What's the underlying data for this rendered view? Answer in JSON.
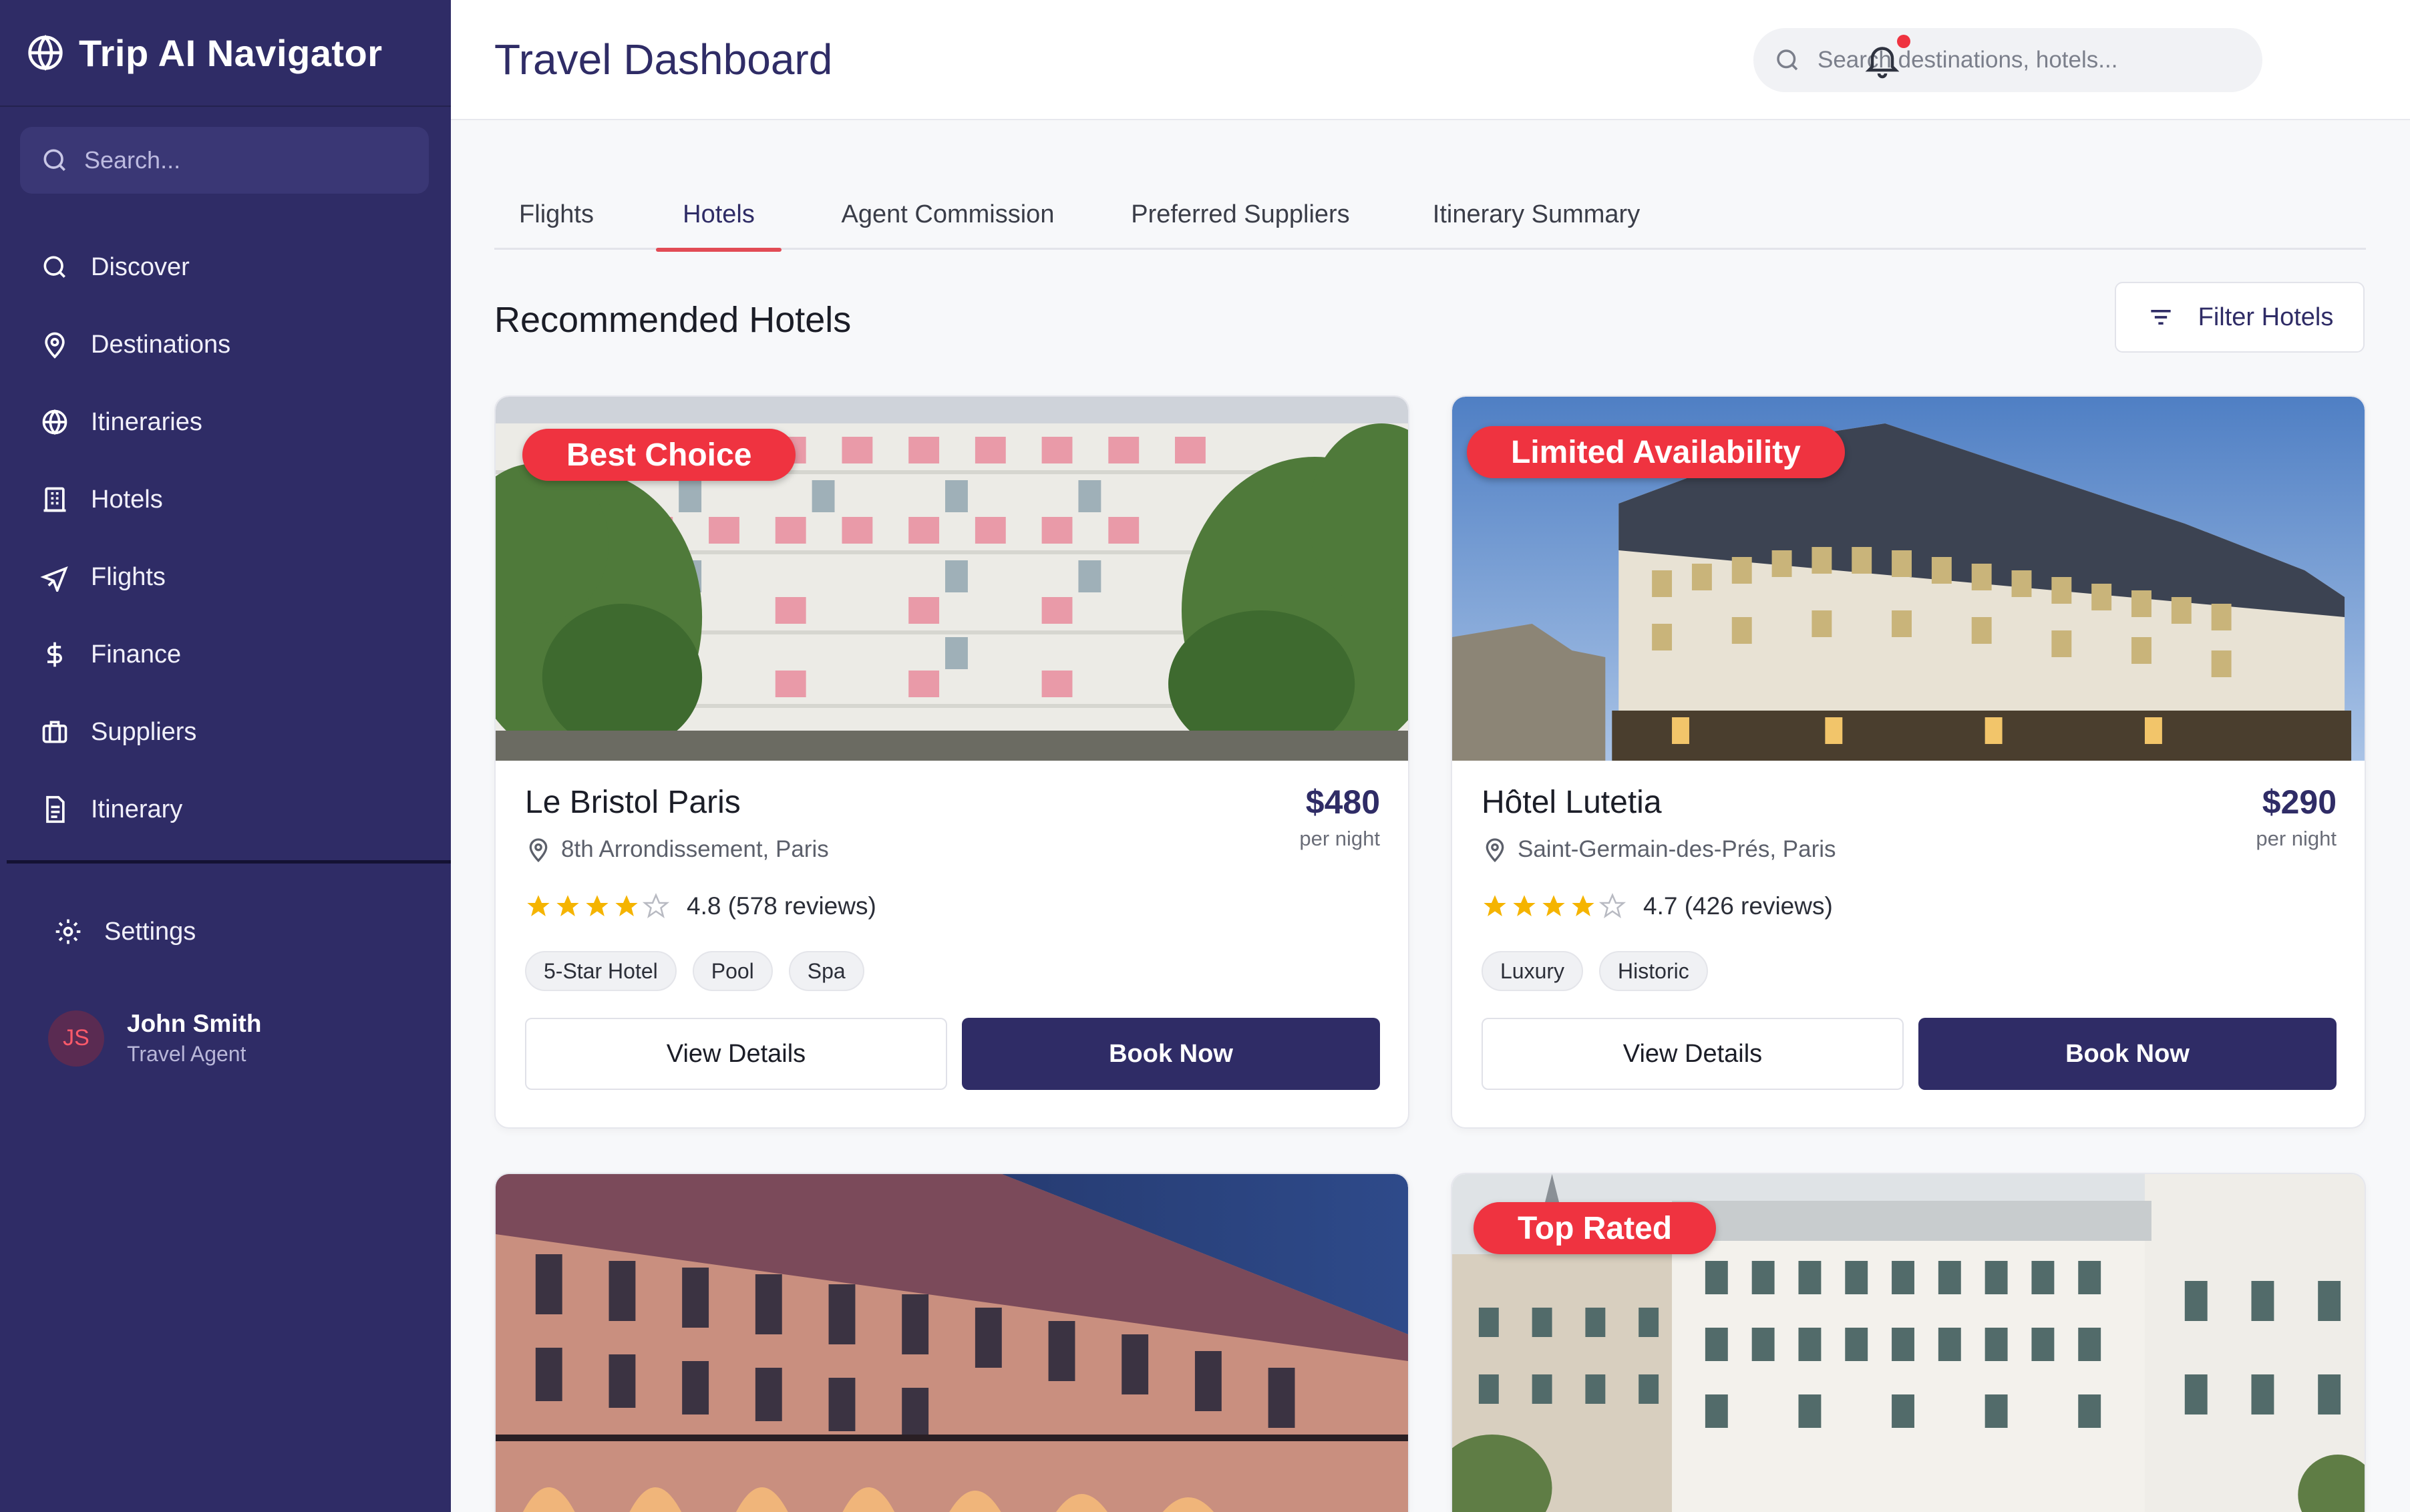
{
  "app": {
    "brand": "Trip AI Navigator"
  },
  "sidebar": {
    "search_placeholder": "Search...",
    "items": [
      {
        "label": "Discover",
        "icon": "search-icon"
      },
      {
        "label": "Destinations",
        "icon": "map-pin-icon"
      },
      {
        "label": "Itineraries",
        "icon": "globe-icon"
      },
      {
        "label": "Hotels",
        "icon": "building-icon"
      },
      {
        "label": "Flights",
        "icon": "plane-icon"
      },
      {
        "label": "Finance",
        "icon": "dollar-icon"
      },
      {
        "label": "Suppliers",
        "icon": "briefcase-icon"
      },
      {
        "label": "Itinerary",
        "icon": "document-icon"
      }
    ],
    "settings_label": "Settings",
    "user": {
      "initials": "JS",
      "name": "John Smith",
      "role": "Travel Agent"
    }
  },
  "header": {
    "title": "Travel Dashboard",
    "search_placeholder": "Search destinations, hotels..."
  },
  "tabs": [
    {
      "label": "Flights",
      "active": false
    },
    {
      "label": "Hotels",
      "active": true
    },
    {
      "label": "Agent Commission",
      "active": false
    },
    {
      "label": "Preferred Suppliers",
      "active": false
    },
    {
      "label": "Itinerary Summary",
      "active": false
    }
  ],
  "section": {
    "title": "Recommended Hotels",
    "filter_label": "Filter Hotels"
  },
  "hotels": [
    {
      "badge": "Best Choice",
      "name": "Le Bristol Paris",
      "location": "8th Arrondissement, Paris",
      "price": "$480",
      "per_night": "per night",
      "rating_text": "4.8 (578 reviews)",
      "stars": 4,
      "tags": [
        "5-Star Hotel",
        "Pool",
        "Spa"
      ],
      "view_label": "View Details",
      "book_label": "Book Now"
    },
    {
      "badge": "Limited Availability",
      "name": "Hôtel Lutetia",
      "location": "Saint-Germain-des-Prés, Paris",
      "price": "$290",
      "per_night": "per night",
      "rating_text": "4.7 (426 reviews)",
      "stars": 4,
      "tags": [
        "Luxury",
        "Historic"
      ],
      "view_label": "View Details",
      "book_label": "Book Now"
    },
    {
      "badge": ""
    },
    {
      "badge": "Top Rated"
    }
  ],
  "colors": {
    "sidebar_bg": "#2f2c66",
    "accent": "#2f2c66",
    "badge": "#ef3340",
    "star": "#f5b400"
  }
}
